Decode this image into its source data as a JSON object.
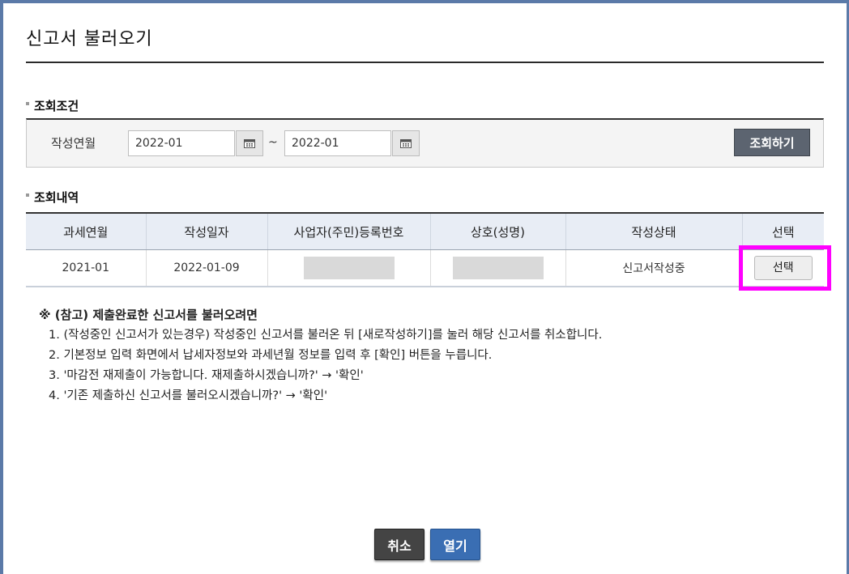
{
  "dialog": {
    "title": "신고서 불러오기"
  },
  "search": {
    "section_title": "조회조건",
    "label": "작성연월",
    "from_value": "2022-01",
    "to_value": "2022-01",
    "separator": "~",
    "button_label": "조회하기"
  },
  "results": {
    "section_title": "조회내역",
    "columns": [
      "과세연월",
      "작성일자",
      "사업자(주민)등록번호",
      "상호(성명)",
      "작성상태",
      "선택"
    ],
    "rows": [
      {
        "period": "2021-01",
        "created": "2022-01-09",
        "status": "신고서작성중",
        "select_label": "선택"
      }
    ]
  },
  "note": {
    "title": "※ (참고) 제출완료한 신고서를 불러오려면",
    "items": [
      "1. (작성중인 신고서가 있는경우) 작성중인 신고서를 불러온 뒤 [새로작성하기]를 눌러 해당 신고서를 취소합니다.",
      "2. 기본정보 입력 화면에서 납세자정보와 과세년월 정보를 입력 후 [확인] 버튼을 누릅니다.",
      "3. '마감전 재제출이 가능합니다. 재제출하시겠습니까?' → '확인'",
      "4. '기존 제출하신 신고서를 불러오시겠습니까?' → '확인'"
    ]
  },
  "footer": {
    "cancel_label": "취소",
    "open_label": "열기"
  },
  "colors": {
    "highlight": "#ff00ff",
    "open_button": "#3a6eb3",
    "search_button": "#5c6470"
  }
}
